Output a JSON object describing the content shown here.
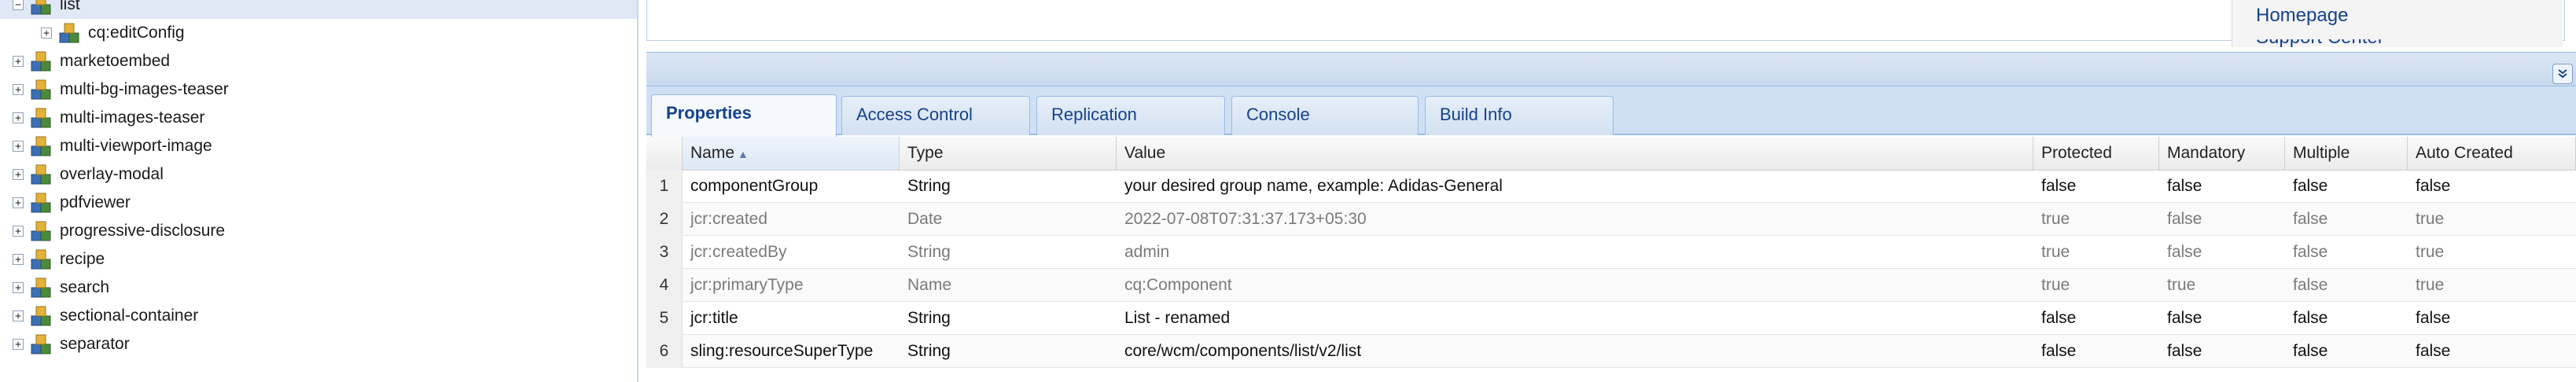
{
  "tree": {
    "items": [
      {
        "label": "list",
        "indent": 0,
        "expander": "−",
        "selected": true
      },
      {
        "label": "cq:editConfig",
        "indent": 1,
        "expander": "+",
        "selected": false
      },
      {
        "label": "marketoembed",
        "indent": 0,
        "expander": "+",
        "selected": false
      },
      {
        "label": "multi-bg-images-teaser",
        "indent": 0,
        "expander": "+",
        "selected": false
      },
      {
        "label": "multi-images-teaser",
        "indent": 0,
        "expander": "+",
        "selected": false
      },
      {
        "label": "multi-viewport-image",
        "indent": 0,
        "expander": "+",
        "selected": false
      },
      {
        "label": "overlay-modal",
        "indent": 0,
        "expander": "+",
        "selected": false
      },
      {
        "label": "pdfviewer",
        "indent": 0,
        "expander": "+",
        "selected": false
      },
      {
        "label": "progressive-disclosure",
        "indent": 0,
        "expander": "+",
        "selected": false
      },
      {
        "label": "recipe",
        "indent": 0,
        "expander": "+",
        "selected": false
      },
      {
        "label": "search",
        "indent": 0,
        "expander": "+",
        "selected": false
      },
      {
        "label": "sectional-container",
        "indent": 0,
        "expander": "+",
        "selected": false
      },
      {
        "label": "separator",
        "indent": 0,
        "expander": "+",
        "selected": false
      }
    ]
  },
  "side_links": {
    "homepage": "Homepage",
    "clipped": "Support Center"
  },
  "panel": {
    "collapse_icon": "double-chevron-down-icon"
  },
  "tabs": [
    {
      "label": "Properties",
      "active": true
    },
    {
      "label": "Access Control",
      "active": false
    },
    {
      "label": "Replication",
      "active": false
    },
    {
      "label": "Console",
      "active": false
    },
    {
      "label": "Build Info",
      "active": false
    }
  ],
  "grid": {
    "columns": [
      "Name",
      "Type",
      "Value",
      "Protected",
      "Mandatory",
      "Multiple",
      "Auto Created"
    ],
    "rows": [
      {
        "num": "1",
        "name": "componentGroup",
        "type": "String",
        "value": "your desired group name, example: Adidas-General",
        "protected": "false",
        "mandatory": "false",
        "multiple": "false",
        "auto_created": "false",
        "muted": false
      },
      {
        "num": "2",
        "name": "jcr:created",
        "type": "Date",
        "value": "2022-07-08T07:31:37.173+05:30",
        "protected": "true",
        "mandatory": "false",
        "multiple": "false",
        "auto_created": "true",
        "muted": true
      },
      {
        "num": "3",
        "name": "jcr:createdBy",
        "type": "String",
        "value": "admin",
        "protected": "true",
        "mandatory": "false",
        "multiple": "false",
        "auto_created": "true",
        "muted": true
      },
      {
        "num": "4",
        "name": "jcr:primaryType",
        "type": "Name",
        "value": "cq:Component",
        "protected": "true",
        "mandatory": "true",
        "multiple": "false",
        "auto_created": "true",
        "muted": true
      },
      {
        "num": "5",
        "name": "jcr:title",
        "type": "String",
        "value": "List - renamed",
        "protected": "false",
        "mandatory": "false",
        "multiple": "false",
        "auto_created": "false",
        "muted": false
      },
      {
        "num": "6",
        "name": "sling:resourceSuperType",
        "type": "String",
        "value": "core/wcm/components/list/v2/list",
        "protected": "false",
        "mandatory": "false",
        "multiple": "false",
        "auto_created": "false",
        "muted": false
      }
    ]
  },
  "colors": {
    "accent": "#15428b",
    "header_bg": "#cfe0f4",
    "selected_row": "#dfe9f5"
  }
}
